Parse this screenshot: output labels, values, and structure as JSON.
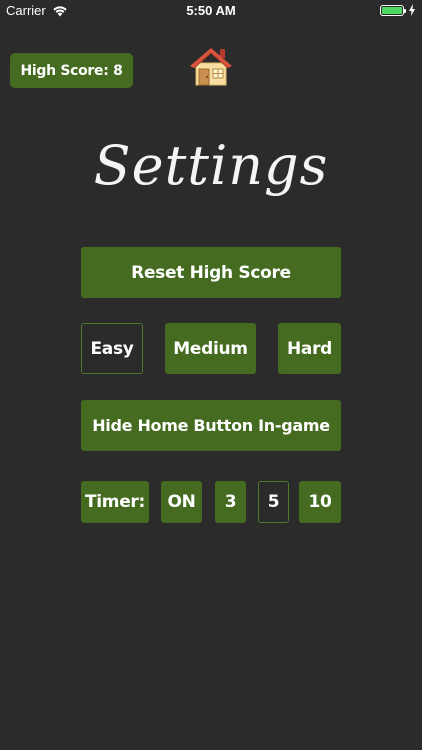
{
  "status_bar": {
    "carrier": "Carrier",
    "time": "5:50 AM",
    "battery_color": "#4cd964"
  },
  "header": {
    "high_score": "High Score: 8",
    "home_icon": "home-icon"
  },
  "title": "Settings",
  "buttons": {
    "reset_high_score": "Reset High Score",
    "difficulty": {
      "easy": "Easy",
      "medium": "Medium",
      "hard": "Hard",
      "selected": "Easy"
    },
    "hide_home": "Hide Home Button In-game"
  },
  "timer": {
    "label": "Timer:",
    "on": "ON",
    "options": [
      "3",
      "5",
      "10"
    ],
    "selected": "5"
  },
  "colors": {
    "background": "#2b2b2b",
    "button_green": "#446b1f",
    "text": "#ffffff"
  }
}
